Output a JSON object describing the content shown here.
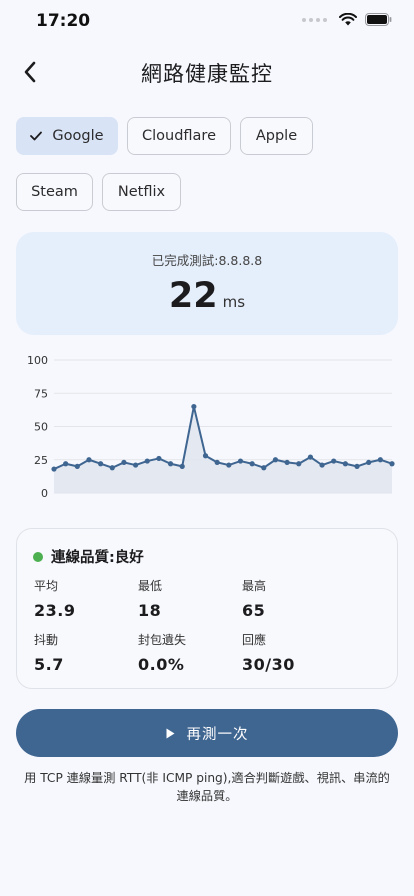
{
  "status_bar": {
    "time": "17:20"
  },
  "header": {
    "title": "網路健康監控"
  },
  "targets": [
    {
      "label": "Google",
      "selected": true
    },
    {
      "label": "Cloudflare",
      "selected": false
    },
    {
      "label": "Apple",
      "selected": false
    },
    {
      "label": "Steam",
      "selected": false
    },
    {
      "label": "Netflix",
      "selected": false
    }
  ],
  "result": {
    "label": "已完成測試:8.8.8.8",
    "value": "22",
    "unit": "ms"
  },
  "chart_data": {
    "type": "area",
    "title": "",
    "xlabel": "",
    "ylabel": "",
    "ylim": [
      0,
      100
    ],
    "yticks": [
      "100",
      "75",
      "50",
      "25",
      "0"
    ],
    "grid": true,
    "x": [
      1,
      2,
      3,
      4,
      5,
      6,
      7,
      8,
      9,
      10,
      11,
      12,
      13,
      14,
      15,
      16,
      17,
      18,
      19,
      20,
      21,
      22,
      23,
      24,
      25,
      26,
      27,
      28,
      29,
      30
    ],
    "values": [
      18,
      22,
      20,
      25,
      22,
      19,
      23,
      21,
      24,
      26,
      22,
      20,
      65,
      28,
      23,
      21,
      24,
      22,
      19,
      25,
      23,
      22,
      27,
      21,
      24,
      22,
      20,
      23,
      25,
      22
    ],
    "line_color": "#3f6591",
    "fill_color": "#dfe5ef"
  },
  "quality": {
    "title": "連線品質:良好",
    "status_color": "#4caf50",
    "stats": [
      {
        "label": "平均",
        "value": "23.9"
      },
      {
        "label": "最低",
        "value": "18"
      },
      {
        "label": "最高",
        "value": "65"
      },
      {
        "label": "抖動",
        "value": "5.7"
      },
      {
        "label": "封包遺失",
        "value": "0.0%"
      },
      {
        "label": "回應",
        "value": "30/30"
      }
    ]
  },
  "action": {
    "retest_label": "再測一次",
    "icon": "play-icon"
  },
  "footnote": "用 TCP 連線量測 RTT(非 ICMP ping),適合判斷遊戲、視訊、串流的連線品質。"
}
